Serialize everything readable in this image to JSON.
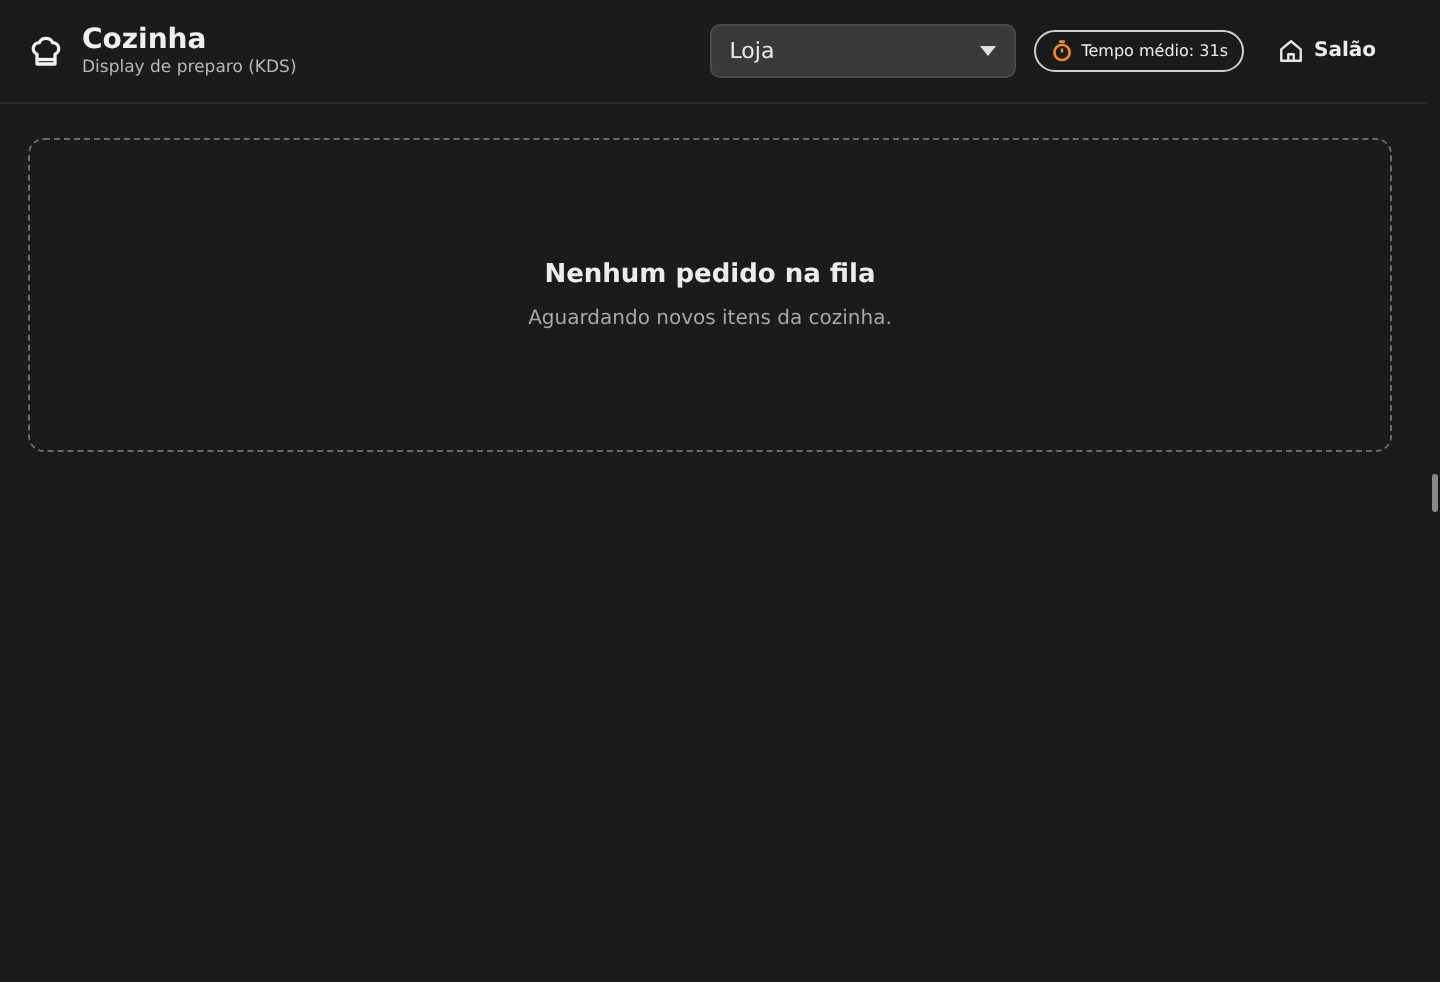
{
  "header": {
    "title": "Cozinha",
    "subtitle": "Display de preparo (KDS)"
  },
  "store_select": {
    "value": "Loja"
  },
  "timer_badge": {
    "label": "Tempo médio: 31s"
  },
  "nav_link": {
    "label": "Salão"
  },
  "empty_state": {
    "title": "Nenhum pedido na fila",
    "message": "Aguardando novos itens da cozinha."
  }
}
